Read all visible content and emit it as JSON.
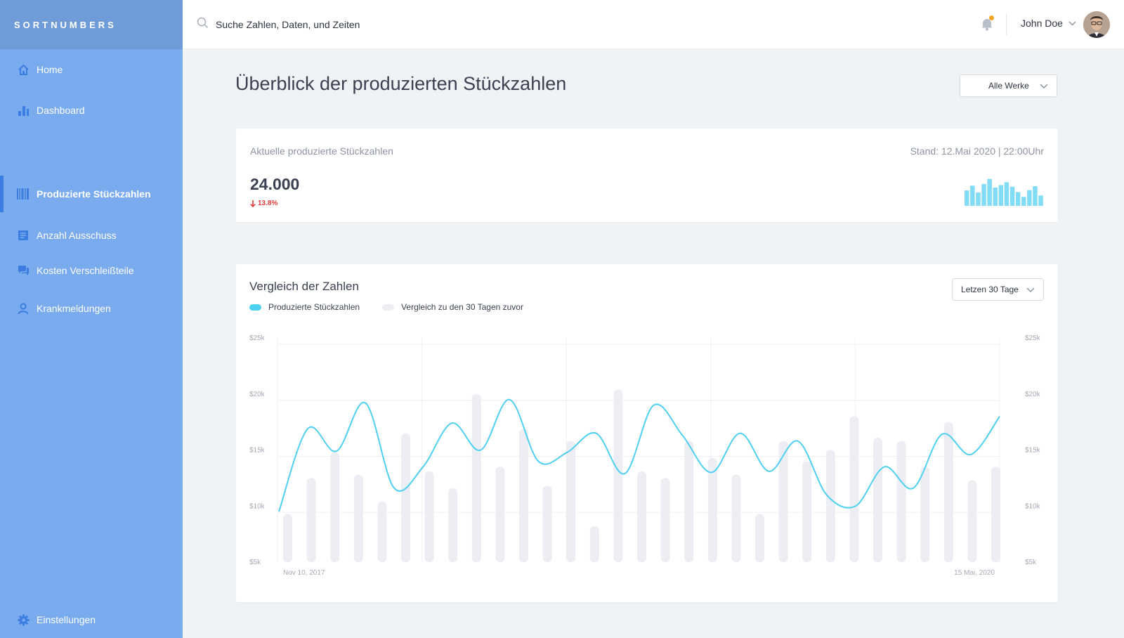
{
  "brand": "SORTNUMBERS",
  "sidebar": {
    "items": [
      {
        "label": "Home",
        "icon": "home-icon"
      },
      {
        "label": "Dashboard",
        "icon": "bar-chart-icon"
      },
      {
        "label": "Produzierte Stückzahlen",
        "icon": "barcode-icon",
        "active": true
      },
      {
        "label": "Anzahl Ausschuss",
        "icon": "document-icon"
      },
      {
        "label": "Kosten Verschleißteile",
        "icon": "chat-icon"
      },
      {
        "label": "Krankmeldungen",
        "icon": "user-icon"
      }
    ],
    "settings_label": "Einstellungen"
  },
  "topbar": {
    "search_placeholder": "Suche Zahlen, Daten, und Zeiten",
    "user_name": "John Doe",
    "notification_dot_color": "#f5a623"
  },
  "main": {
    "title": "Überblick der produzierten Stückzahlen",
    "plant_select": "Alle Werke",
    "summary": {
      "label": "Aktuelle produzierte Stückzahlen",
      "stand": "Stand: 12.Mai 2020 | 22:00Uhr",
      "value": "24.000",
      "delta": "13.8%",
      "delta_direction": "down",
      "delta_color": "#e33b3b"
    },
    "comparison": {
      "title": "Vergleich der Zahlen",
      "range_select": "Letzen 30 Tage",
      "legend_current": "Produzierte Stückzahlen",
      "legend_previous": "Vergleich zu den 30 Tagen zuvor"
    }
  },
  "colors": {
    "sidebar": "#7aabee",
    "brand_bar": "#6f9bd9",
    "accent": "#3b7de0",
    "line": "#4fd0f0",
    "bars": "#eceef4"
  },
  "chart_data": {
    "type": "bar",
    "title": "Vergleich der Zahlen",
    "y_ticks": [
      "$5k",
      "$10k",
      "$15k",
      "$20k",
      "$25k"
    ],
    "ylim": [
      5,
      25
    ],
    "x_labels": [
      "Nov 10, 2017",
      "15 Mai, 2020"
    ],
    "series": [
      {
        "name": "Vergleich zu den 30 Tagen zuvor",
        "type": "bar",
        "values": [
          9.3,
          12.5,
          14.8,
          12.8,
          10.4,
          16.5,
          13.1,
          11.6,
          20.0,
          13.5,
          16.9,
          11.8,
          15.8,
          8.2,
          20.4,
          13.1,
          12.5,
          15.8,
          14.3,
          12.8,
          9.3,
          15.8,
          14.0,
          15.0,
          18.0,
          16.1,
          15.8,
          13.5,
          17.5,
          12.3,
          13.5
        ]
      },
      {
        "name": "Produzierte Stückzahlen",
        "type": "line",
        "values": [
          9.5,
          16.9,
          14.9,
          19.2,
          11.6,
          13.5,
          17.4,
          15.0,
          19.5,
          14.0,
          14.8,
          16.5,
          12.9,
          19.0,
          16.3,
          13.0,
          16.5,
          13.1,
          15.8,
          11.0,
          10.0,
          13.5,
          11.6,
          16.4,
          14.6,
          18.0
        ]
      }
    ],
    "sparkline": [
      5.5,
      7.2,
      4.8,
      7.8,
      9.6,
      6.5,
      7.4,
      8.4,
      6.8,
      4.9,
      3.2,
      5.6,
      7.0,
      3.7
    ]
  }
}
